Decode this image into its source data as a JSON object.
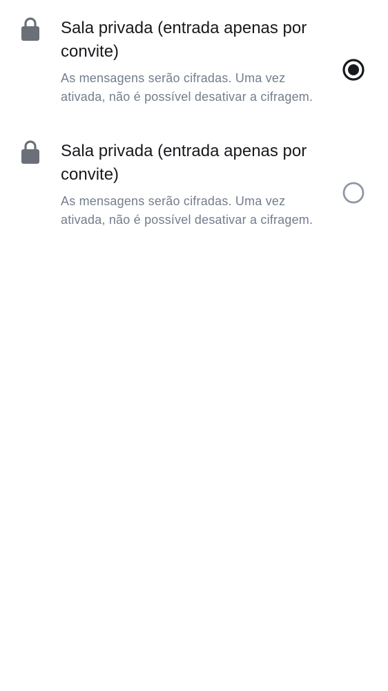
{
  "options": [
    {
      "title": "Sala privada (entrada apenas por convite)",
      "description": "As mensagens serão cifradas. Uma vez ativada, não é possível desativar a cifragem.",
      "icon": "lock-icon",
      "selected": true
    },
    {
      "title": "Sala privada (entrada apenas por convite)",
      "description": "As mensagens serão cifradas. Uma vez ativada, não é possível desativar a cifragem.",
      "icon": "lock-icon",
      "selected": false
    }
  ],
  "colors": {
    "title": "#17191c",
    "description": "#737d8c",
    "icon": "#6b6f77",
    "radio_selected": "#17191c",
    "radio_unselected": "#8d97a5"
  }
}
